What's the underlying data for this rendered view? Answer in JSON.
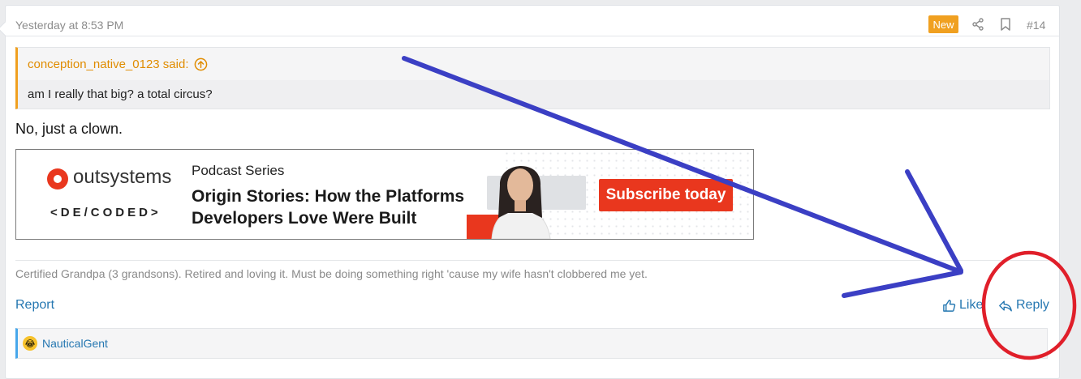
{
  "post": {
    "date": "Yesterday at 8:53 PM",
    "badge": "New",
    "number": "#14",
    "icons": [
      "share-icon",
      "bookmark-icon"
    ]
  },
  "quote": {
    "author_label": "conception_native_0123 said:",
    "text": "am I really that big? a total circus?"
  },
  "body": {
    "text": "No, just a clown."
  },
  "ad": {
    "brand": "outsystems",
    "decoded": "<DE/CODED>",
    "series": "Podcast Series",
    "headline_line1": "Origin Stories: How the Platforms",
    "headline_line2": "Developers Love Were Built",
    "cta": "Subscribe today",
    "accent": "#e9371e"
  },
  "signature": {
    "text": "Certified Grandpa (3 grandsons). Retired and loving it. Must be doing something right 'cause my wife hasn't clobbered me yet."
  },
  "actions": {
    "report": "Report",
    "like": "Like",
    "reply": "Reply"
  },
  "reactions": {
    "emoji": "laughing-face-icon",
    "user": "NauticalGent"
  },
  "colors": {
    "link": "#2577b1",
    "quote_accent": "#f0a020",
    "annotation_arrow": "#3b3fc4",
    "annotation_circle": "#e01f2a"
  }
}
